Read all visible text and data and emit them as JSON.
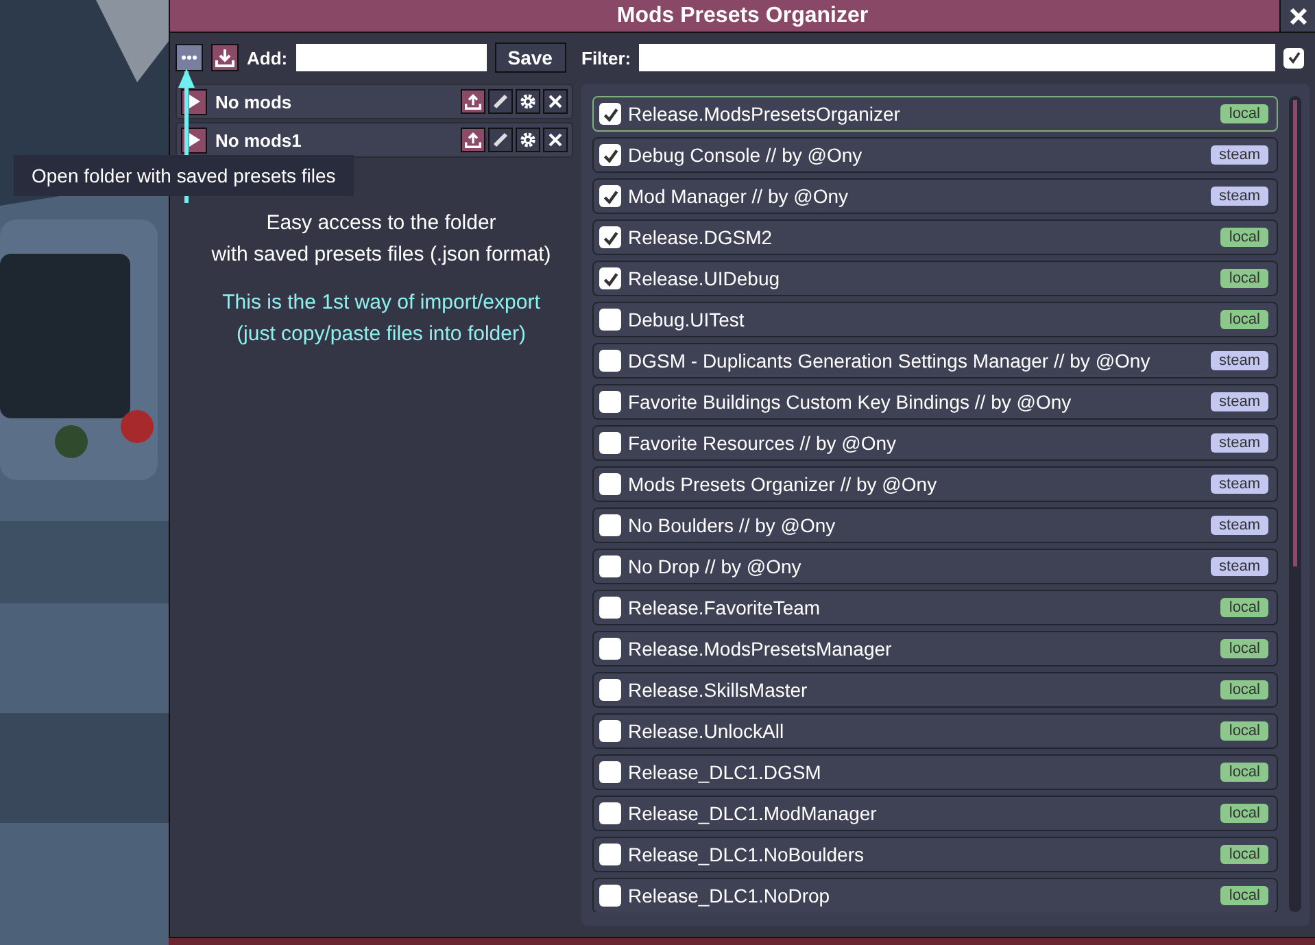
{
  "window": {
    "title": "Mods Presets Organizer"
  },
  "toolbar": {
    "add_label": "Add:",
    "save_button": "Save",
    "filter_label": "Filter:",
    "filter_checked": true
  },
  "tooltip": "Open folder with saved presets files",
  "presets": [
    {
      "name": "No mods"
    },
    {
      "name": "No mods1"
    }
  ],
  "annotation": {
    "lines": [
      "Easy access to the folder",
      "with saved presets files (.json format)"
    ],
    "note": [
      "This is the 1st way of import/export",
      "(just copy/paste files into folder)"
    ]
  },
  "mods": [
    {
      "name": "Release.ModsPresetsOrganizer",
      "checked": true,
      "selected": true,
      "source": "local"
    },
    {
      "name": "Debug Console // by @Ony",
      "checked": true,
      "selected": false,
      "source": "steam"
    },
    {
      "name": "Mod Manager // by @Ony",
      "checked": true,
      "selected": false,
      "source": "steam"
    },
    {
      "name": "Release.DGSM2",
      "checked": true,
      "selected": false,
      "source": "local"
    },
    {
      "name": "Release.UIDebug",
      "checked": true,
      "selected": false,
      "source": "local"
    },
    {
      "name": "Debug.UITest",
      "checked": false,
      "selected": false,
      "source": "local"
    },
    {
      "name": "DGSM  - Duplicants Generation Settings Manager // by @Ony",
      "checked": false,
      "selected": false,
      "source": "steam"
    },
    {
      "name": "Favorite Buildings  Custom Key Bindings // by @Ony",
      "checked": false,
      "selected": false,
      "source": "steam"
    },
    {
      "name": "Favorite Resources // by @Ony",
      "checked": false,
      "selected": false,
      "source": "steam"
    },
    {
      "name": "Mods Presets Organizer // by @Ony",
      "checked": false,
      "selected": false,
      "source": "steam"
    },
    {
      "name": "No Boulders // by @Ony",
      "checked": false,
      "selected": false,
      "source": "steam"
    },
    {
      "name": "No Drop // by @Ony",
      "checked": false,
      "selected": false,
      "source": "steam"
    },
    {
      "name": "Release.FavoriteTeam",
      "checked": false,
      "selected": false,
      "source": "local"
    },
    {
      "name": "Release.ModsPresetsManager",
      "checked": false,
      "selected": false,
      "source": "local"
    },
    {
      "name": "Release.SkillsMaster",
      "checked": false,
      "selected": false,
      "source": "local"
    },
    {
      "name": "Release.UnlockAll",
      "checked": false,
      "selected": false,
      "source": "local"
    },
    {
      "name": "Release_DLC1.DGSM",
      "checked": false,
      "selected": false,
      "source": "local"
    },
    {
      "name": "Release_DLC1.ModManager",
      "checked": false,
      "selected": false,
      "source": "local"
    },
    {
      "name": "Release_DLC1.NoBoulders",
      "checked": false,
      "selected": false,
      "source": "local"
    },
    {
      "name": "Release_DLC1.NoDrop",
      "checked": false,
      "selected": false,
      "source": "local"
    }
  ]
}
